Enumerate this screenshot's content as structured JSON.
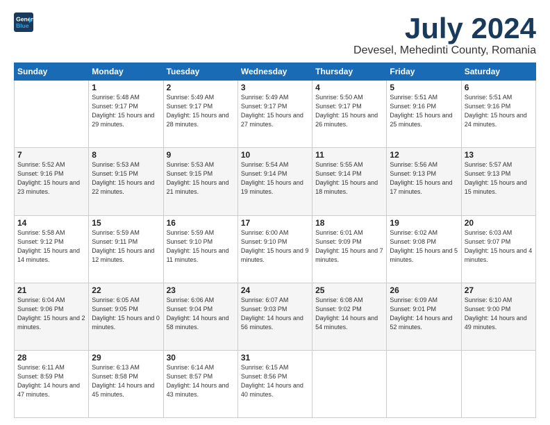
{
  "logo": {
    "line1": "General",
    "line2": "Blue"
  },
  "title": "July 2024",
  "subtitle": "Devesel, Mehedinti County, Romania",
  "weekdays": [
    "Sunday",
    "Monday",
    "Tuesday",
    "Wednesday",
    "Thursday",
    "Friday",
    "Saturday"
  ],
  "weeks": [
    [
      {
        "day": "",
        "info": ""
      },
      {
        "day": "1",
        "info": "Sunrise: 5:48 AM\nSunset: 9:17 PM\nDaylight: 15 hours\nand 29 minutes."
      },
      {
        "day": "2",
        "info": "Sunrise: 5:49 AM\nSunset: 9:17 PM\nDaylight: 15 hours\nand 28 minutes."
      },
      {
        "day": "3",
        "info": "Sunrise: 5:49 AM\nSunset: 9:17 PM\nDaylight: 15 hours\nand 27 minutes."
      },
      {
        "day": "4",
        "info": "Sunrise: 5:50 AM\nSunset: 9:17 PM\nDaylight: 15 hours\nand 26 minutes."
      },
      {
        "day": "5",
        "info": "Sunrise: 5:51 AM\nSunset: 9:16 PM\nDaylight: 15 hours\nand 25 minutes."
      },
      {
        "day": "6",
        "info": "Sunrise: 5:51 AM\nSunset: 9:16 PM\nDaylight: 15 hours\nand 24 minutes."
      }
    ],
    [
      {
        "day": "7",
        "info": "Sunrise: 5:52 AM\nSunset: 9:16 PM\nDaylight: 15 hours\nand 23 minutes."
      },
      {
        "day": "8",
        "info": "Sunrise: 5:53 AM\nSunset: 9:15 PM\nDaylight: 15 hours\nand 22 minutes."
      },
      {
        "day": "9",
        "info": "Sunrise: 5:53 AM\nSunset: 9:15 PM\nDaylight: 15 hours\nand 21 minutes."
      },
      {
        "day": "10",
        "info": "Sunrise: 5:54 AM\nSunset: 9:14 PM\nDaylight: 15 hours\nand 19 minutes."
      },
      {
        "day": "11",
        "info": "Sunrise: 5:55 AM\nSunset: 9:14 PM\nDaylight: 15 hours\nand 18 minutes."
      },
      {
        "day": "12",
        "info": "Sunrise: 5:56 AM\nSunset: 9:13 PM\nDaylight: 15 hours\nand 17 minutes."
      },
      {
        "day": "13",
        "info": "Sunrise: 5:57 AM\nSunset: 9:13 PM\nDaylight: 15 hours\nand 15 minutes."
      }
    ],
    [
      {
        "day": "14",
        "info": "Sunrise: 5:58 AM\nSunset: 9:12 PM\nDaylight: 15 hours\nand 14 minutes."
      },
      {
        "day": "15",
        "info": "Sunrise: 5:59 AM\nSunset: 9:11 PM\nDaylight: 15 hours\nand 12 minutes."
      },
      {
        "day": "16",
        "info": "Sunrise: 5:59 AM\nSunset: 9:10 PM\nDaylight: 15 hours\nand 11 minutes."
      },
      {
        "day": "17",
        "info": "Sunrise: 6:00 AM\nSunset: 9:10 PM\nDaylight: 15 hours\nand 9 minutes."
      },
      {
        "day": "18",
        "info": "Sunrise: 6:01 AM\nSunset: 9:09 PM\nDaylight: 15 hours\nand 7 minutes."
      },
      {
        "day": "19",
        "info": "Sunrise: 6:02 AM\nSunset: 9:08 PM\nDaylight: 15 hours\nand 5 minutes."
      },
      {
        "day": "20",
        "info": "Sunrise: 6:03 AM\nSunset: 9:07 PM\nDaylight: 15 hours\nand 4 minutes."
      }
    ],
    [
      {
        "day": "21",
        "info": "Sunrise: 6:04 AM\nSunset: 9:06 PM\nDaylight: 15 hours\nand 2 minutes."
      },
      {
        "day": "22",
        "info": "Sunrise: 6:05 AM\nSunset: 9:05 PM\nDaylight: 15 hours\nand 0 minutes."
      },
      {
        "day": "23",
        "info": "Sunrise: 6:06 AM\nSunset: 9:04 PM\nDaylight: 14 hours\nand 58 minutes."
      },
      {
        "day": "24",
        "info": "Sunrise: 6:07 AM\nSunset: 9:03 PM\nDaylight: 14 hours\nand 56 minutes."
      },
      {
        "day": "25",
        "info": "Sunrise: 6:08 AM\nSunset: 9:02 PM\nDaylight: 14 hours\nand 54 minutes."
      },
      {
        "day": "26",
        "info": "Sunrise: 6:09 AM\nSunset: 9:01 PM\nDaylight: 14 hours\nand 52 minutes."
      },
      {
        "day": "27",
        "info": "Sunrise: 6:10 AM\nSunset: 9:00 PM\nDaylight: 14 hours\nand 49 minutes."
      }
    ],
    [
      {
        "day": "28",
        "info": "Sunrise: 6:11 AM\nSunset: 8:59 PM\nDaylight: 14 hours\nand 47 minutes."
      },
      {
        "day": "29",
        "info": "Sunrise: 6:13 AM\nSunset: 8:58 PM\nDaylight: 14 hours\nand 45 minutes."
      },
      {
        "day": "30",
        "info": "Sunrise: 6:14 AM\nSunset: 8:57 PM\nDaylight: 14 hours\nand 43 minutes."
      },
      {
        "day": "31",
        "info": "Sunrise: 6:15 AM\nSunset: 8:56 PM\nDaylight: 14 hours\nand 40 minutes."
      },
      {
        "day": "",
        "info": ""
      },
      {
        "day": "",
        "info": ""
      },
      {
        "day": "",
        "info": ""
      }
    ]
  ]
}
